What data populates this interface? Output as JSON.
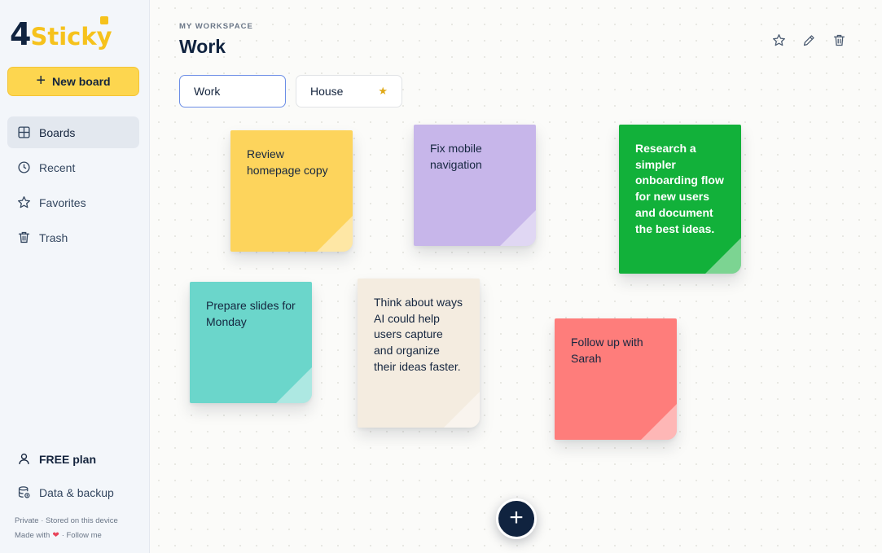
{
  "app": {
    "logo_digit": "4",
    "logo_word": "Sticky"
  },
  "sidebar": {
    "new_board_label": "New board",
    "items": [
      {
        "label": "Boards",
        "icon": "grid-icon",
        "active": true
      },
      {
        "label": "Recent",
        "icon": "clock-icon",
        "active": false
      },
      {
        "label": "Favorites",
        "icon": "star-icon",
        "active": false
      },
      {
        "label": "Trash",
        "icon": "trash-icon",
        "active": false
      }
    ],
    "plan_label": "FREE plan",
    "backup_label": "Data & backup",
    "footer_privacy": "Private · Stored on this device",
    "footer_made_with": "Made with",
    "footer_follow": "· Follow me"
  },
  "header": {
    "eyebrow": "MY WORKSPACE",
    "title": "Work",
    "icons": [
      "star-outline-icon",
      "pencil-icon",
      "trash-icon"
    ]
  },
  "tabs": [
    {
      "label": "Work",
      "active": true,
      "favorite": false
    },
    {
      "label": "House",
      "active": false,
      "favorite": true
    }
  ],
  "notes": [
    {
      "text": "Review homepage copy",
      "color": "#fdd45c"
    },
    {
      "text": "Fix mobile navigation",
      "color": "#c7b6ea"
    },
    {
      "text": "Research a simpler onboarding flow for new users and document the best ideas.",
      "color": "#12b13a"
    },
    {
      "text": "Prepare slides for Monday",
      "color": "#6bd6cb"
    },
    {
      "text": "Think about ways AI could help users capture and organize their ideas faster.",
      "color": "#f4ece0"
    },
    {
      "text": "Follow up with Sarah",
      "color": "#fe7d7b"
    }
  ],
  "colors": {
    "accent_yellow": "#fdd64f",
    "navy": "#10233f",
    "tab_active_border": "#6c8ee6"
  }
}
